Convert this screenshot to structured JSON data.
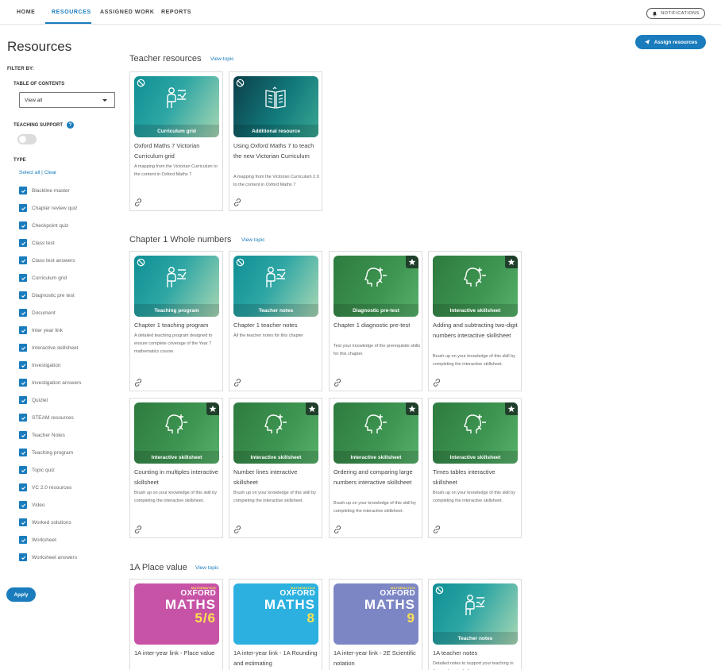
{
  "nav": {
    "items": [
      "HOME",
      "RESOURCES",
      "ASSIGNED WORK",
      "REPORTS"
    ],
    "notifications": "NOTIFICATIONS"
  },
  "page_title": "Resources",
  "sidebar": {
    "filter_by": "FILTER BY:",
    "toc_label": "TABLE OF CONTENTS",
    "toc_value": "View all",
    "teaching_support": "TEACHING SUPPORT",
    "help": "?",
    "type_label": "TYPE",
    "select_all": "Select all",
    "sep": " | ",
    "clear": "Clear",
    "types": [
      "Blackline master",
      "Chapter review quiz",
      "Checkpoint quiz",
      "Class test",
      "Class test answers",
      "Curriculum grid",
      "Diagnostic pre test",
      "Document",
      "Inter year link",
      "Interactive skillsheet",
      "Investigation",
      "Investigation answers",
      "Quizlet",
      "STEAM resources",
      "Teacher Notes",
      "Teaching program",
      "Topic quiz",
      "VC 2.0 resources",
      "Video",
      "Worked solutions",
      "Worksheet",
      "Worksheet answers"
    ],
    "apply": "Apply"
  },
  "assign_button": "Assign resources",
  "view_topic": "View topic",
  "sections": [
    {
      "title": "Teacher resources",
      "cards": [
        {
          "label": "Curriculum grid",
          "title": "Oxford Maths 7 Victorian Curriculum grid",
          "desc": "A mapping from the Victorian Curriculum to the content in Oxford Maths 7."
        },
        {
          "label": "Additional resource",
          "title": "Using Oxford Maths 7 to teach the new Victorian Curriculum",
          "desc": "A mapping from the Victorian Curriculum 2.0 to the content in Oxford Maths 7"
        }
      ]
    },
    {
      "title": "Chapter 1 Whole numbers",
      "cards": [
        {
          "label": "Teaching program",
          "title": "Chapter 1 teaching program",
          "desc": "A detailed teaching program designed to ensure complete coverage of the Year 7 mathematics course."
        },
        {
          "label": "Teacher notes",
          "title": "Chapter 1 teacher notes",
          "desc": "All the teacher notes for this chapter"
        },
        {
          "label": "Diagnostic pre-test",
          "title": "Chapter 1 diagnostic pre-test",
          "desc": "Test your knowledge of the prerequisite skills for this chapter."
        },
        {
          "label": "Interactive skillsheet",
          "title": "Adding and subtracting two-digit numbers interactive skillsheet",
          "desc": "Brush up on your knowledge of this skill by completing the interactive skillsheet."
        },
        {
          "label": "Interactive skillsheet",
          "title": "Counting in multiples interactive skillsheet",
          "desc": "Brush up on your knowledge of this skill by completing the interactive skillsheet."
        },
        {
          "label": "Interactive skillsheet",
          "title": "Number lines interactive skillsheet",
          "desc": "Brush up on your knowledge of this skill by completing the interactive skillsheet."
        },
        {
          "label": "Interactive skillsheet",
          "title": "Ordering and comparing large numbers interactive skillsheet",
          "desc": "Brush up on your knowledge of this skill by completing the interactive skillsheet."
        },
        {
          "label": "Interactive skillsheet",
          "title": "Times tables interactive skillsheet",
          "desc": "Brush up on your knowledge of this skill by completing the interactive skillsheet."
        }
      ]
    },
    {
      "title": "1A Place value",
      "cards": [
        {
          "title": "1A inter-year link - Place value",
          "brand_ox": "OXFORD",
          "brand_m1": "MATHS",
          "brand_num": "5/6",
          "brand_strip": "MATHEMATICS"
        },
        {
          "title": "1A inter-year link - 1A Rounding and estimating",
          "brand_ox": "OXFORD",
          "brand_m1": "MATHS",
          "brand_num": "8",
          "brand_strip": "MATHEMATICS"
        },
        {
          "title": "1A inter-year link - 2E Scientific notation",
          "brand_ox": "OXFORD",
          "brand_m1": "MATHS",
          "brand_num": "9",
          "brand_strip": "MATHEMATICS"
        },
        {
          "label": "Teacher notes",
          "title": "1A teacher notes",
          "desc": "Detailed notes to support your teaching in this section, including"
        }
      ]
    }
  ],
  "colors": {
    "accent": "#1a7cbd",
    "teal": "#2ea6a4",
    "green": "#3e9652"
  },
  "icons": [
    "bell-icon",
    "caret-down-icon",
    "check-icon",
    "help-icon",
    "send-icon",
    "ban-icon",
    "star-icon",
    "link-icon",
    "teacher-icon",
    "book-icon",
    "head-icon"
  ]
}
